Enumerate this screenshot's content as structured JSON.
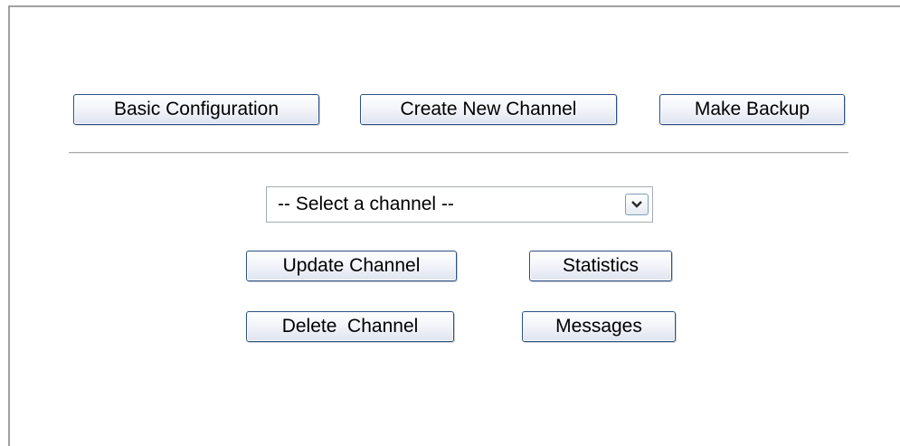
{
  "toolbar": {
    "basic_configuration": "Basic Configuration",
    "create_new_channel": "Create New Channel",
    "make_backup": "Make Backup"
  },
  "channel_select": {
    "selected": "-- Select a channel --"
  },
  "actions": {
    "update_channel": "Update Channel",
    "statistics": "Statistics",
    "delete_channel": "Delete  Channel",
    "messages": "Messages"
  },
  "icons": {
    "dropdown": "chevron-down-icon"
  },
  "colors": {
    "button_border": "#2c4f85",
    "divider": "#a8a8a8",
    "panel_border": "#a0a0a0"
  }
}
